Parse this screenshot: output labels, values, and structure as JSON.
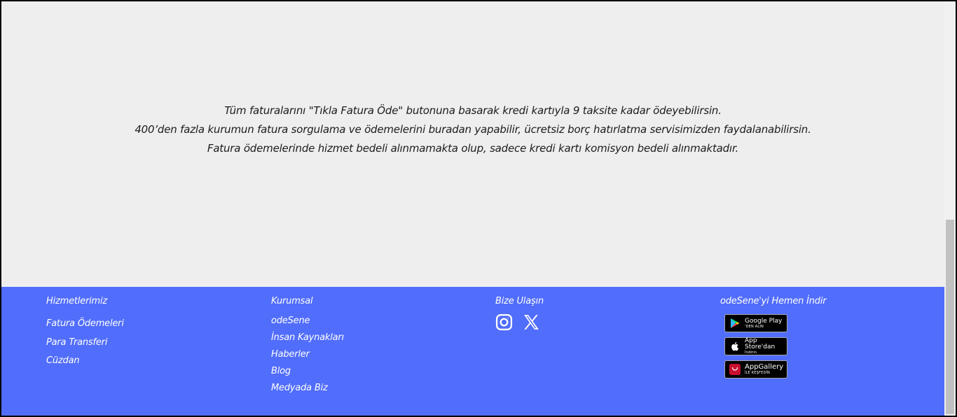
{
  "info": {
    "line1": "Tüm faturalarını \"Tıkla Fatura Öde\" butonuna basarak kredi kartıyla 9 taksite kadar ödeyebilirsin.",
    "line2": "400’den fazla kurumun fatura sorgulama ve ödemelerini buradan yapabilir, ücretsiz borç hatırlatma servisimizden faydalanabilirsin.",
    "line3": "Fatura ödemelerinde hizmet bedeli alınmamakta olup, sadece kredi kartı komisyon bedeli alınmaktadır."
  },
  "footer": {
    "background": "#516dfb",
    "services": {
      "title": "Hizmetlerimiz",
      "items": [
        "Fatura Ödemeleri",
        "Para Transferi",
        "Cüzdan"
      ]
    },
    "corporate": {
      "title": "Kurumsal",
      "items": [
        "odeSene",
        "İnsan Kaynakları",
        "Haberler",
        "Blog",
        "Medyada Biz"
      ]
    },
    "contact": {
      "title": "Bize Ulaşın",
      "icons": [
        "instagram-icon",
        "x-twitter-icon"
      ]
    },
    "download": {
      "title": "odeSene'yi Hemen İndir",
      "google_play": {
        "main": "Google Play",
        "sub": "'DEN ALIN"
      },
      "app_store": {
        "main": "App Store'dan",
        "sub": "İndirin"
      },
      "app_gallery": {
        "main": "AppGallery",
        "sub": "İLE KEŞFEDİN"
      }
    }
  }
}
